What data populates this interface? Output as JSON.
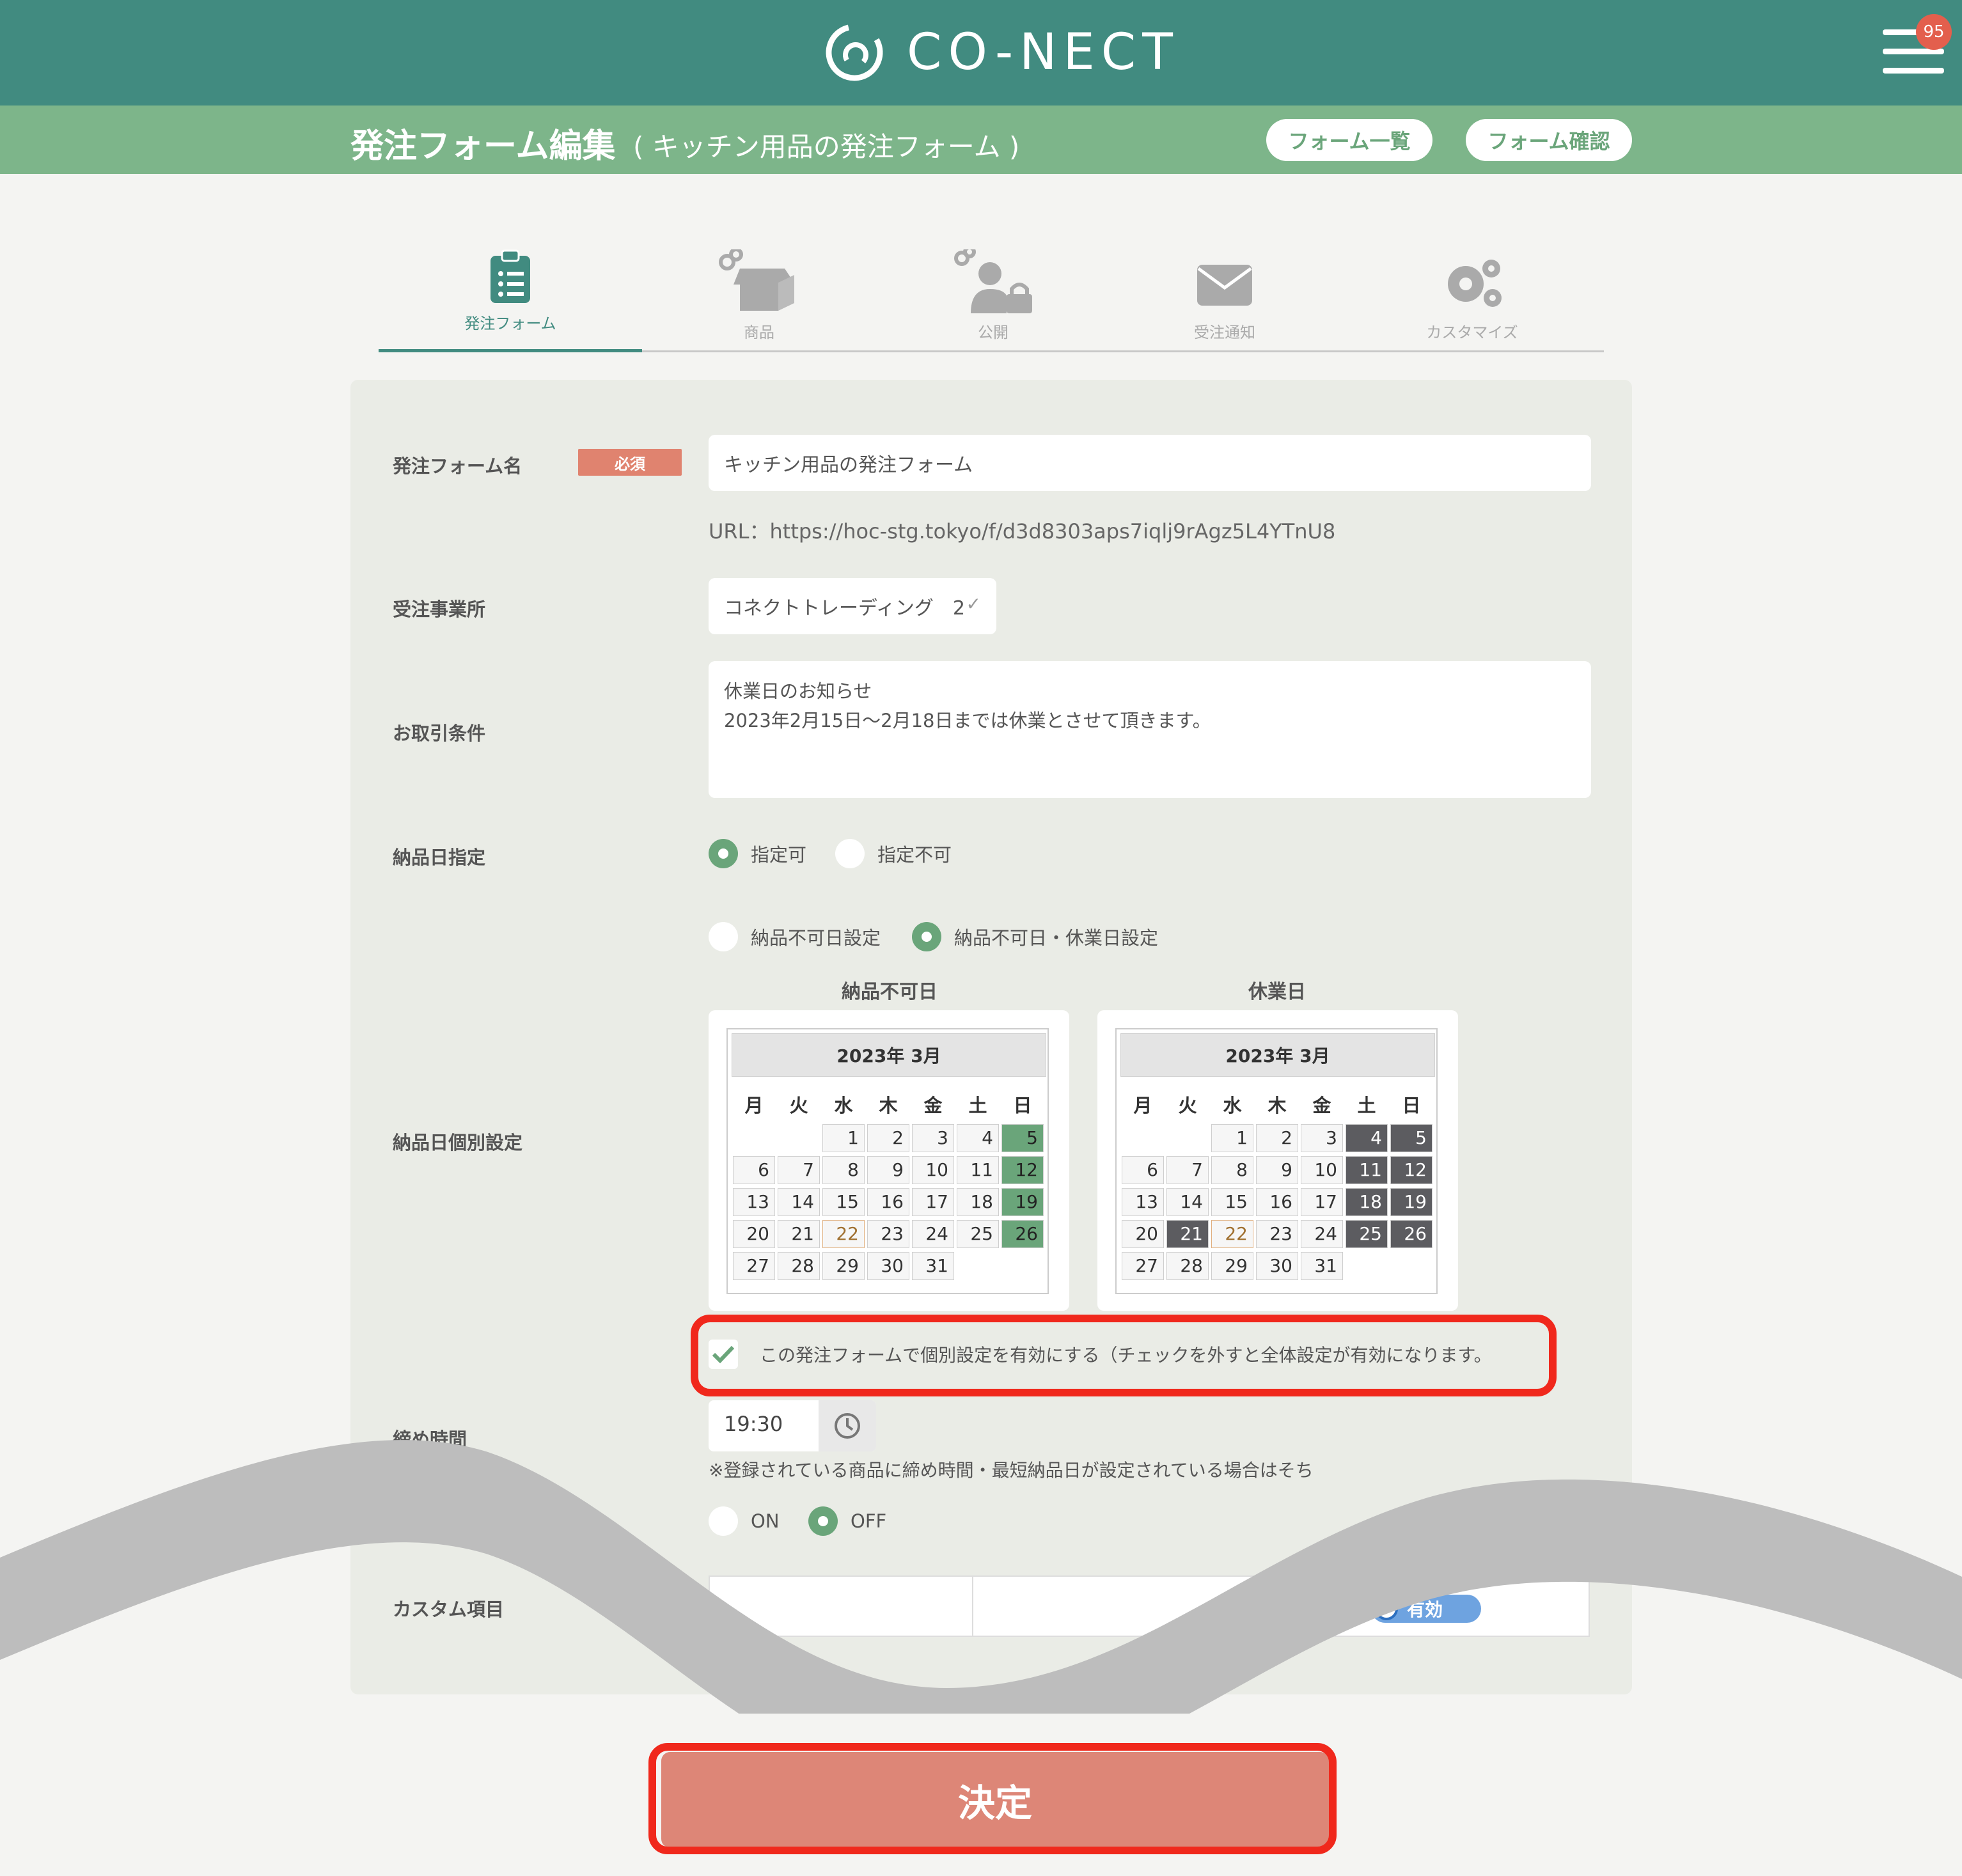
{
  "header": {
    "logo_text": "CO-NECT",
    "notification_count": "95",
    "colors": {
      "header": "#418b80",
      "subheader": "#7db58a",
      "accent_red": "#e0836f"
    }
  },
  "subheader": {
    "title": "発注フォーム編集",
    "subtitle": "( キッチン用品の発注フォーム )",
    "form_list_button": "フォーム一覧",
    "form_confirm_button": "フォーム確認"
  },
  "tabs": [
    {
      "label": "発注フォーム",
      "icon": "clipboard-list-icon",
      "active": true
    },
    {
      "label": "商品",
      "icon": "box-link-icon",
      "active": false
    },
    {
      "label": "公開",
      "icon": "user-lock-link-icon",
      "active": false
    },
    {
      "label": "受注通知",
      "icon": "envelope-icon",
      "active": false
    },
    {
      "label": "カスタマイズ",
      "icon": "gears-icon",
      "active": false
    }
  ],
  "form": {
    "form_name_label": "発注フォーム名",
    "required_badge": "必須",
    "form_name_value": "キッチン用品の発注フォーム",
    "url_text": "URL：https://hoc-stg.tokyo/f/d3d8303aps7iqlj9rAgz5L4YTnU8",
    "office_label": "受注事業所",
    "office_value": "コネクトトレーディング　2",
    "terms_label": "お取引条件",
    "terms_line1": "休業日のお知らせ",
    "terms_line2": "2023年2月15日〜2月18日までは休業とさせて頂きます。",
    "delivery_label": "納品日指定",
    "delivery_opt_yes": "指定可",
    "delivery_opt_no": "指定不可",
    "individual_label": "納品日個別設定",
    "mode_opt1": "納品不可日設定",
    "mode_opt2": "納品不可日・休業日設定",
    "cal1_title": "納品不可日",
    "cal2_title": "休業日",
    "cal_month": "2023年 3月",
    "weekdays": [
      "月",
      "火",
      "水",
      "木",
      "金",
      "土",
      "日"
    ],
    "individual_check_text": "この発注フォームで個別設定を有効にする（チェックを外すと全体設定が有効になります。",
    "deadline_label": "締め時間",
    "deadline_value": "19:30",
    "deadline_note": "※登録されている商品に締め時間・最短納品日が設定されている場合はそち",
    "on_label": "ON",
    "off_label": "OFF",
    "custom_label": "カスタム項目",
    "custom_toggle": "有効",
    "submit": "決定"
  }
}
